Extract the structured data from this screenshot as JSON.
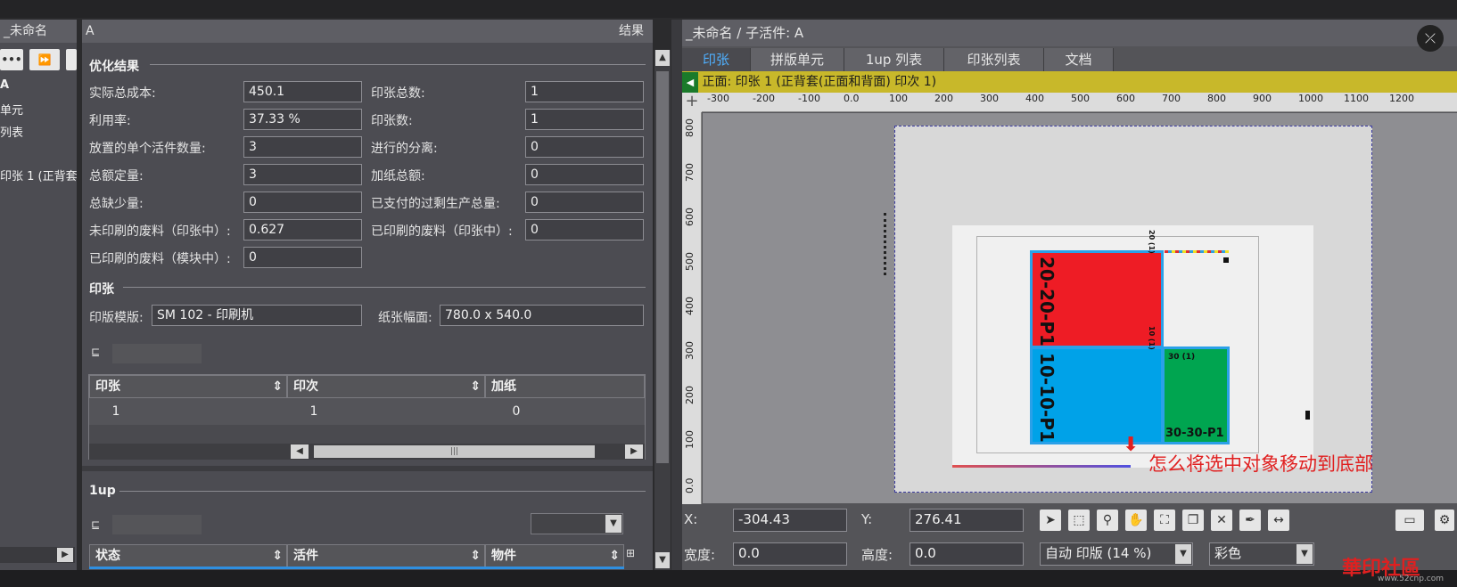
{
  "left_panel": {
    "title": "_未命名",
    "btn1": "•••",
    "btn2": "⏩",
    "items": [
      "A",
      "单元",
      "列表",
      "印张 1 (正背套("
    ]
  },
  "mid_panel": {
    "title": "A",
    "title_right": "结果",
    "opt_section": "优化结果",
    "left_fields": [
      {
        "label": "实际总成本:",
        "value": "450.1"
      },
      {
        "label": "利用率:",
        "value": "37.33 %"
      },
      {
        "label": "放置的单个活件数量:",
        "value": "3"
      },
      {
        "label": "总额定量:",
        "value": "3"
      },
      {
        "label": "总缺少量:",
        "value": "0"
      },
      {
        "label": "未印刷的废料（印张中）:",
        "value": "0.627"
      },
      {
        "label": "已印刷的废料（模块中）:",
        "value": "0"
      }
    ],
    "right_fields": [
      {
        "label": "印张总数:",
        "value": "1"
      },
      {
        "label": "印张数:",
        "value": "1"
      },
      {
        "label": "进行的分离:",
        "value": "0"
      },
      {
        "label": "加纸总额:",
        "value": "0"
      },
      {
        "label": "已支付的过剩生产总量:",
        "value": "0"
      },
      {
        "label": "已印刷的废料（印张中）:",
        "value": "0"
      }
    ],
    "sheet_section": "印张",
    "press_label": "印版模版:",
    "press_value": "SM 102 - 印刷机",
    "paper_label": "纸张幅面:",
    "paper_value": "780.0 x 540.0",
    "table": {
      "headers": [
        "印张",
        "印次",
        "加纸"
      ],
      "rows": [
        [
          "1",
          "1",
          "0"
        ]
      ]
    },
    "oneup_section": "1up",
    "oneup_headers": [
      "状态",
      "活件",
      "物件"
    ]
  },
  "right_panel": {
    "title": "_未命名 / 子活件: A",
    "tabs": [
      "印张",
      "拼版单元",
      "1up 列表",
      "印张列表",
      "文档"
    ],
    "active_tab": 0,
    "sheet_bar": "正面: 印张 1 (正背套(正面和背面) 印次 1)",
    "ruler_x": [
      "-300",
      "-200",
      "-100",
      "0.0",
      "100",
      "200",
      "300",
      "400",
      "500",
      "600",
      "700",
      "800",
      "900",
      "1000",
      "1100",
      "1200"
    ],
    "ruler_y": [
      "800",
      "700",
      "600",
      "500",
      "400",
      "300",
      "200",
      "100",
      "0.0"
    ],
    "blocks": [
      {
        "text": "20-20-P1",
        "small": "20 (1)",
        "color": "#ee1c25"
      },
      {
        "text": "10-10-P1",
        "small": "10 (1)",
        "color": "#00a2e8"
      },
      {
        "text": "30-30-P1",
        "small": "30 (1)",
        "color": "#00a550"
      }
    ],
    "annotation": "怎么将选中对象移动到底部",
    "x_label": "X:",
    "x_value": "-304.43",
    "y_label": "Y:",
    "y_value": "276.41",
    "w_label": "宽度:",
    "w_value": "0.0",
    "h_label": "高度:",
    "h_value": "0.0",
    "zoom_value": "自动 印版 (14 %)",
    "color_value": "彩色"
  },
  "watermark": {
    "text": "華印社區",
    "sub": "www.52cnp.com"
  }
}
